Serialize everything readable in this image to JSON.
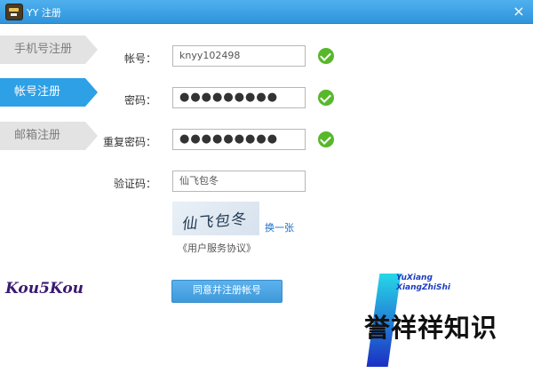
{
  "window": {
    "title": "YY 注册",
    "close_label": "×"
  },
  "sidebar": {
    "tabs": [
      {
        "label": "手机号注册",
        "active": false
      },
      {
        "label": "帐号注册",
        "active": true
      },
      {
        "label": "邮箱注册",
        "active": false
      }
    ]
  },
  "form": {
    "account": {
      "label": "帐号：",
      "value": "knyy102498",
      "valid": true
    },
    "password": {
      "label": "密码：",
      "value": "●●●●●●●●●",
      "valid": true
    },
    "confirm": {
      "label": "重复密码：",
      "value": "●●●●●●●●●",
      "valid": true
    },
    "captcha": {
      "label": "验证码：",
      "value": "仙飞包冬",
      "image_text": "仙飞包冬",
      "refresh_label": "换一张"
    },
    "agreement_label": "《用户服务协议》",
    "submit_label": "同意并注册帐号"
  },
  "signature": "Kou5Kou",
  "watermark": {
    "line1": "YuXiang",
    "line2": "XiangZhiShi",
    "main": "誉祥祥知识"
  },
  "colors": {
    "title_bar": "#2f94db",
    "active_tab": "#2ea0e6",
    "inactive_tab": "#e3e3e3",
    "check": "#57b82a",
    "link": "#1a6fc9",
    "button": "#4aa4e2"
  }
}
